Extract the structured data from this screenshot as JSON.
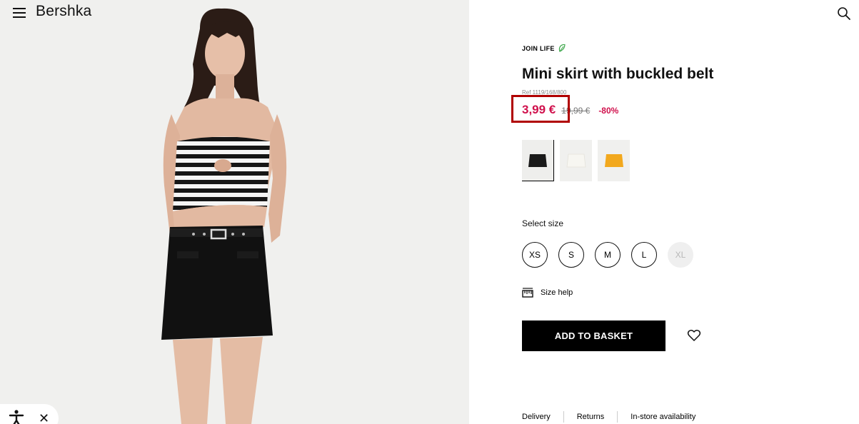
{
  "header": {
    "menu_icon": "hamburger-menu-icon",
    "logo": "Bershka",
    "search_icon": "search-icon"
  },
  "product": {
    "tag": "JOIN LIFE",
    "tag_icon": "leaf-icon",
    "tag_icon_color": "#3aa648",
    "title": "Mini skirt with buckled belt",
    "ref": "Ref 1119/168/800",
    "price_now": "3,99 €",
    "price_old": "19,99 €",
    "discount": "-80%",
    "price_color": "#d0104c"
  },
  "colors": [
    {
      "name": "black",
      "hex": "#1a1a1a",
      "selected": true
    },
    {
      "name": "white",
      "hex": "#f4f3ef",
      "selected": false
    },
    {
      "name": "yellow",
      "hex": "#f2a81d",
      "selected": false
    }
  ],
  "sizes": {
    "label": "Select size",
    "options": [
      "XS",
      "S",
      "M",
      "L",
      "XL"
    ],
    "disabled": [
      "XL"
    ]
  },
  "size_help": {
    "label": "Size help",
    "icon": "ruler-icon"
  },
  "actions": {
    "add_to_basket": "ADD TO BASKET",
    "favorite_icon": "heart-icon"
  },
  "bottom_links": [
    "Delivery",
    "Returns",
    "In-store availability"
  ],
  "accessibility": {
    "icon": "accessibility-icon",
    "close_icon": "close-icon"
  },
  "highlight_color": "#b00000"
}
